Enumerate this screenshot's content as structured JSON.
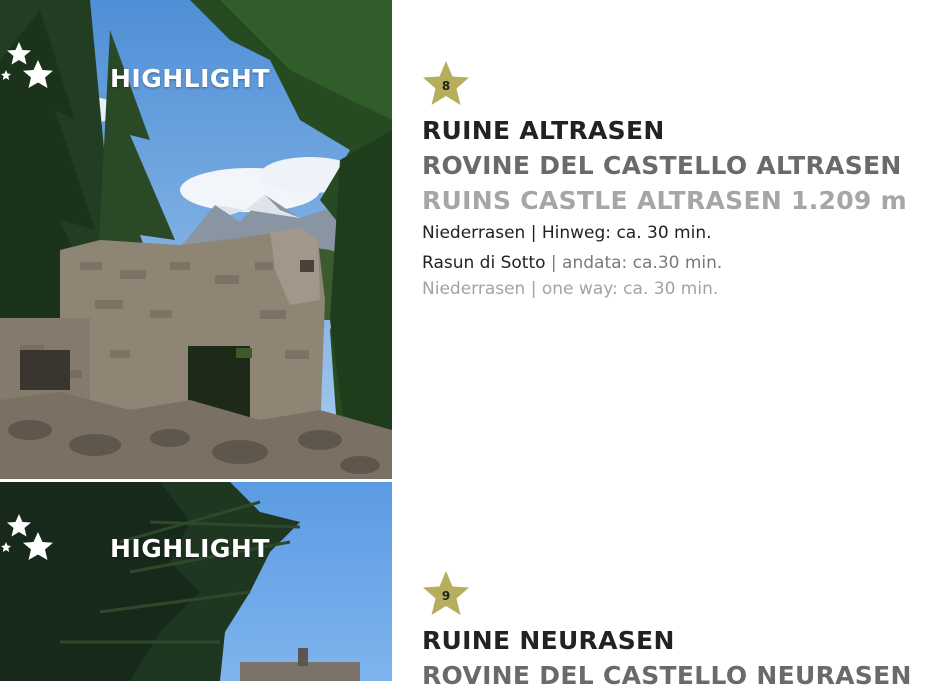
{
  "colors": {
    "badge_fill": "#b6ae5c",
    "title_primary": "#222222",
    "title_secondary": "#6a6a6a",
    "title_tertiary": "#a6a6a6"
  },
  "entries": [
    {
      "highlight_label": "HIGHLIGHT",
      "number": "8",
      "title_de": "RUINE ALTRASEN",
      "title_it": "ROVINE DEL CASTELLO ALTRASEN",
      "title_en": "RUINS CASTLE ALTRASEN 1.209 m",
      "line_de": "Niederrasen | Hinweg: ca. 30 min.",
      "line_it_place": "Rasun di Sotto",
      "line_it_rest": " | andata: ca.30 min.",
      "line_en": "Niederrasen | one way: ca. 30 min.",
      "photo_icon": "castle-ruin-photo"
    },
    {
      "highlight_label": "HIGHLIGHT",
      "number": "9",
      "title_de": "RUINE NEURASEN",
      "title_it": "ROVINE DEL CASTELLO NEURASEN",
      "photo_icon": "tree-sky-photo"
    }
  ]
}
